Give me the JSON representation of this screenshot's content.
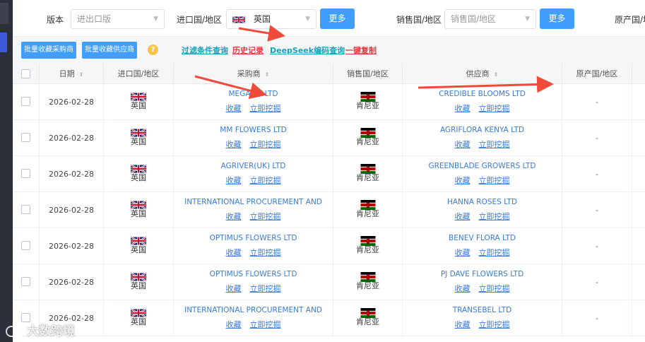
{
  "filters": {
    "version_label": "版本",
    "version_placeholder": "进出口版",
    "import_country_label": "进口国/地区",
    "import_country_value": "英国",
    "more_label_1": "更多",
    "sales_country_label": "销售国/地区",
    "sales_country_placeholder": "销售国/地区",
    "more_label_2": "更多",
    "origin_country_label": "原产国/地区"
  },
  "toolbar": {
    "bulk_fav_buyer": "批量收藏采购商",
    "bulk_fav_supplier": "批量收藏供应商",
    "help_icon": "?",
    "link_filter_query": "过滤条件查询",
    "link_history": "历史记录",
    "link_deepseek": "DeepSeek编码查询",
    "link_copy": "一键复制"
  },
  "table": {
    "headers": {
      "date": "日期",
      "import_country": "进口国/地区",
      "buyer": "采购商",
      "sales_country": "销售国/地区",
      "supplier": "供应商",
      "origin_country": "原产国/地区"
    },
    "action_favorite": "收藏",
    "action_mine": "立即挖掘",
    "rows": [
      {
        "date": "2026-02-28",
        "import_country": "英国",
        "buyer": "MEGALLY LTD",
        "sales_country": "肯尼亚",
        "supplier": "CREDIBLE BLOOMS LTD",
        "origin": "-"
      },
      {
        "date": "2026-02-28",
        "import_country": "英国",
        "buyer": "MM FLOWERS LTD",
        "sales_country": "肯尼亚",
        "supplier": "AGRIFLORA KENYA LTD",
        "origin": "-"
      },
      {
        "date": "2026-02-28",
        "import_country": "英国",
        "buyer": "AGRIVER(UK) LTD",
        "sales_country": "肯尼亚",
        "supplier": "GREENBLADE GROWERS LTD",
        "origin": "-"
      },
      {
        "date": "2026-02-28",
        "import_country": "英国",
        "buyer": "INTERNATIONAL PROCUREMENT AND",
        "sales_country": "肯尼亚",
        "supplier": "HANNA ROSES LTD",
        "origin": "-"
      },
      {
        "date": "2026-02-28",
        "import_country": "英国",
        "buyer": "OPTIMUS FLOWERS LTD",
        "sales_country": "肯尼亚",
        "supplier": "BENEV FLORA LTD",
        "origin": "-"
      },
      {
        "date": "2026-02-28",
        "import_country": "英国",
        "buyer": "OPTIMUS FLOWERS LTD",
        "sales_country": "肯尼亚",
        "supplier": "PJ DAVE FLOWERS LTD",
        "origin": "-"
      },
      {
        "date": "2026-02-28",
        "import_country": "英国",
        "buyer": "INTERNATIONAL PROCUREMENT AND",
        "sales_country": "肯尼亚",
        "supplier": "TRANSEBEL LTD",
        "origin": "-"
      }
    ]
  },
  "watermark": "大数跨境",
  "colors": {
    "primary": "#409eff",
    "link": "#3a7bd5",
    "accent_red": "#e4393c",
    "accent_cyan": "#17a2b8",
    "arrow": "#f04a3a"
  }
}
